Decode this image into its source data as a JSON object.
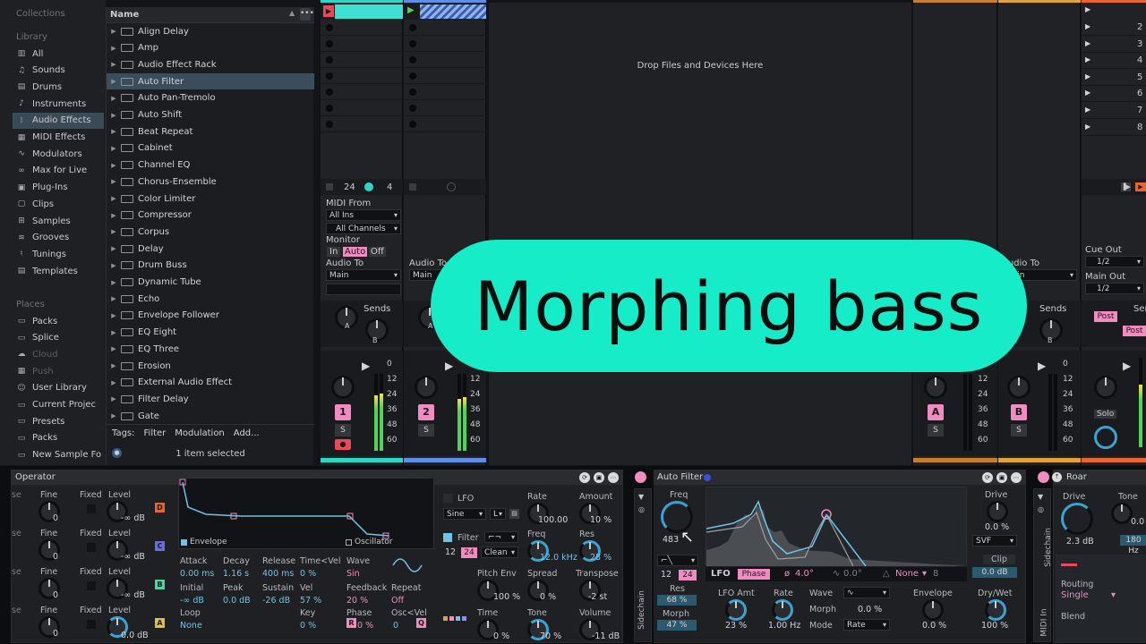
{
  "browser": {
    "collections_label": "Collections",
    "library_label": "Library",
    "library": [
      {
        "label": "All",
        "icon": "all-icon"
      },
      {
        "label": "Sounds",
        "icon": "sounds-icon"
      },
      {
        "label": "Drums",
        "icon": "drums-icon"
      },
      {
        "label": "Instruments",
        "icon": "instruments-icon"
      },
      {
        "label": "Audio Effects",
        "icon": "audio-effects-icon"
      },
      {
        "label": "MIDI Effects",
        "icon": "midi-effects-icon"
      },
      {
        "label": "Modulators",
        "icon": "modulators-icon"
      },
      {
        "label": "Max for Live",
        "icon": "max-for-live-icon"
      },
      {
        "label": "Plug-Ins",
        "icon": "plugins-icon"
      },
      {
        "label": "Clips",
        "icon": "clips-icon"
      },
      {
        "label": "Samples",
        "icon": "samples-icon"
      },
      {
        "label": "Grooves",
        "icon": "grooves-icon"
      },
      {
        "label": "Tunings",
        "icon": "tunings-icon"
      },
      {
        "label": "Templates",
        "icon": "templates-icon"
      }
    ],
    "places_label": "Places",
    "places": [
      {
        "label": "Packs",
        "icon": "folder-icon"
      },
      {
        "label": "Splice",
        "icon": "folder-icon"
      },
      {
        "label": "Cloud",
        "icon": "cloud-icon"
      },
      {
        "label": "Push",
        "icon": "push-icon"
      },
      {
        "label": "User Library",
        "icon": "user-icon"
      },
      {
        "label": "Current Projec",
        "icon": "folder-icon"
      },
      {
        "label": "Presets",
        "icon": "folder-icon"
      },
      {
        "label": "Packs",
        "icon": "folder-icon"
      },
      {
        "label": "New Sample Fo",
        "icon": "folder-icon"
      }
    ],
    "name_header": "Name",
    "items": [
      "Align Delay",
      "Amp",
      "Audio Effect Rack",
      "Auto Filter",
      "Auto Pan-Tremolo",
      "Auto Shift",
      "Beat Repeat",
      "Cabinet",
      "Channel EQ",
      "Chorus-Ensemble",
      "Color Limiter",
      "Compressor",
      "Corpus",
      "Delay",
      "Drum Buss",
      "Dynamic Tube",
      "Echo",
      "Envelope Follower",
      "EQ Eight",
      "EQ Three",
      "Erosion",
      "External Audio Effect",
      "Filter Delay",
      "Gate"
    ],
    "tags_label": "Tags:",
    "tags": [
      "Filter",
      "Modulation",
      "Add..."
    ],
    "status": "1 item selected"
  },
  "session": {
    "drop_text": "Drop Files and Devices Here",
    "scene_numbers": [
      "2",
      "3",
      "4",
      "5",
      "6",
      "7",
      "8"
    ],
    "track_settings": {
      "zoom1": "24",
      "zoom2": "4",
      "midi_from": "MIDI From",
      "all_ins": "All Ins",
      "all_channels": "All Channels",
      "monitor": "Monitor",
      "mon_in": "In",
      "mon_auto": "Auto",
      "mon_off": "Off",
      "audio_to": "Audio To",
      "main": "Main",
      "sends": "Sends",
      "send_a": "A",
      "send_b": "B",
      "cue_out": "Cue Out",
      "cue_val": "1/2",
      "main_out": "Main Out",
      "main_val": "1/2",
      "post": "Post"
    },
    "meter_scale": [
      "0",
      "12",
      "24",
      "36",
      "48",
      "60"
    ],
    "tracks": [
      {
        "number": "1",
        "solo": "S"
      },
      {
        "number": "2",
        "solo": "S"
      },
      {
        "number": "A",
        "solo": "S"
      },
      {
        "number": "B",
        "solo": "S"
      }
    ],
    "master_solo": "Solo"
  },
  "overlay": {
    "title": "Morphing bass"
  },
  "devices": {
    "operator": {
      "title": "Operator",
      "col_labels": [
        "Fine",
        "Fixed",
        "Level"
      ],
      "level_vals": [
        "-∞ dB",
        "-∞ dB",
        "-∞ dB",
        "0.0 dB"
      ],
      "fine_vals": [
        "0",
        "0",
        "0",
        "0"
      ],
      "osc_letters": [
        "D",
        "C",
        "B",
        "A"
      ],
      "envelope": "Envelope",
      "oscillator": "Oscillator",
      "params": [
        {
          "label": "Attack",
          "value": "0.00 ms"
        },
        {
          "label": "Decay",
          "value": "1.16 s"
        },
        {
          "label": "Release",
          "value": "400 ms"
        },
        {
          "label": "Time<Vel",
          "value": "0 %"
        },
        {
          "label": "Wave",
          "value": "Sin"
        },
        {
          "label": "Initial",
          "value": "-∞ dB"
        },
        {
          "label": "Peak",
          "value": "0.0 dB"
        },
        {
          "label": "Sustain",
          "value": "-26 dB"
        },
        {
          "label": "Vel",
          "value": "57 %"
        },
        {
          "label": "Feedback",
          "value": "20 %"
        },
        {
          "label": "Repeat",
          "value": "Off"
        },
        {
          "label": "Loop",
          "value": "None"
        },
        {
          "label": "Key",
          "value": "0 %"
        },
        {
          "label": "Phase",
          "value": "0 %"
        },
        {
          "label": "Osc<Vel",
          "value": "0"
        }
      ],
      "lfo": "LFO",
      "lfo_wave": "Sine",
      "lfo_mode": "L",
      "rate": "Rate",
      "rate_val": "100.00",
      "amount": "Amount",
      "amount_val": "10 %",
      "filter": "Filter",
      "filter_slope1": "12",
      "filter_slope2": "24",
      "filter_circuit": "Clean",
      "freq": "Freq",
      "freq_val": "12.0 kHz",
      "res": "Res",
      "res_val": "28 %",
      "pitch_env": "Pitch Env",
      "pitch_env_val": "100 %",
      "spread": "Spread",
      "spread_val": "0 %",
      "transpose": "Transpose",
      "transpose_val": "-2 st",
      "time": "Time",
      "time_val": "0 %",
      "tone": "Tone",
      "tone_val": "70 %",
      "volume": "Volume",
      "volume_val": "-11 dB"
    },
    "sidechain_label": "Sidechain",
    "auto_filter": {
      "title": "Auto Filter",
      "freq": "Freq",
      "freq_val": "483",
      "slope1": "12",
      "slope2": "24",
      "res": "Res",
      "res_val": "68 %",
      "morph": "Morph",
      "morph_val": "47 %",
      "lfo": "LFO",
      "phase": "Phase",
      "phase_val": "4.0°",
      "offset_val": "0.0°",
      "sync_val": "None",
      "sync_num": "8",
      "lfo_amt": "LFO Amt",
      "lfo_amt_val": "23 %",
      "rate": "Rate",
      "rate_val": "1.00 Hz",
      "wave": "Wave",
      "morph2": "Morph",
      "morph2_val": "0.0 %",
      "mode": "Mode",
      "mode_val": "Rate",
      "envelope": "Envelope",
      "envelope_val": "0.0 %",
      "drive": "Drive",
      "drive_val": "0.0 %",
      "filter_type": "SVF",
      "clip": "Clip",
      "clip_val": "0.0 dB",
      "drywet": "Dry/Wet",
      "drywet_val": "100 %"
    },
    "midi_in_label": "MIDI In",
    "roar": {
      "title": "Roar",
      "drive": "Drive",
      "drive_val": "2.3 dB",
      "tone": "Tone",
      "tone_val": "0.0 %",
      "tone_hz": "180 Hz",
      "routing": "Routing",
      "routing_val": "Single",
      "blend": "Blend"
    }
  }
}
